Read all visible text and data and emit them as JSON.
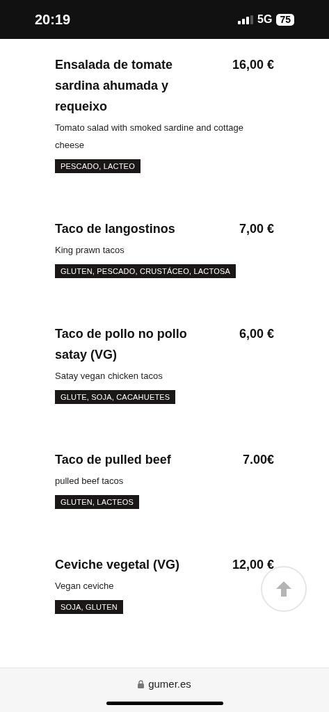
{
  "status_bar": {
    "time": "20:19",
    "network": "5G",
    "battery": "75"
  },
  "items": [
    {
      "title": "Ensalada de tomate sardina ahumada y requeixo",
      "price": "16,00 €",
      "description": "Tomato salad with smoked sardine and cottage cheese",
      "allergens": "PESCADO, LACTEO"
    },
    {
      "title": "Taco de langostinos",
      "price": "7,00 €",
      "description": "King prawn tacos",
      "allergens": "GLUTEN, PESCADO, CRUSTÁCEO, LACTOSA"
    },
    {
      "title": "Taco de pollo no pollo satay (VG)",
      "price": "6,00 €",
      "description": "Satay vegan chicken tacos",
      "allergens": "GLUTE, SOJA, CACAHUETES"
    },
    {
      "title": "Taco de pulled beef",
      "price": "7.00€",
      "description": "pulled beef tacos",
      "allergens": "GLUTEN, LACTEOS"
    },
    {
      "title": "Ceviche vegetal (VG)",
      "price": "12,00 €",
      "description": "Vegan ceviche",
      "allergens": "SOJA, GLUTEN"
    }
  ],
  "address_bar": {
    "url": "gumer.es"
  }
}
